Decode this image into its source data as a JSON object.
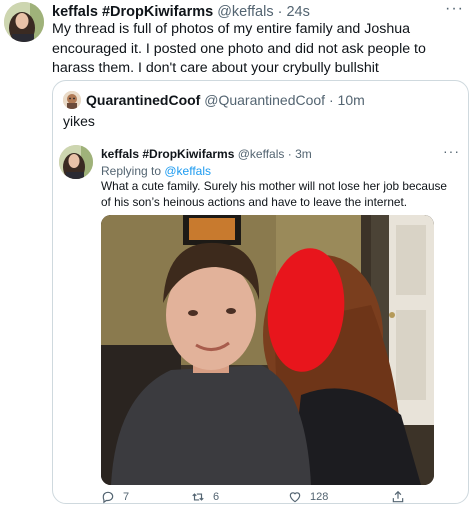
{
  "main_tweet": {
    "display_name": "keffals #DropKiwifarms",
    "handle": "@keffals",
    "separator": "·",
    "time": "24s",
    "text": "My thread is full of photos of my entire family and Joshua encouraged it. I posted one photo and did not ask people to harass them. I don't care about your crybully bullshit",
    "more_icon": "more-dots-icon"
  },
  "quoted_tweet": {
    "display_name": "QuarantinedCoof",
    "handle": "@QuarantinedCoof",
    "separator": "·",
    "time": "10m",
    "text": "yikes"
  },
  "inner_tweet": {
    "display_name": "keffals #DropKiwifarms",
    "handle": "@keffals",
    "separator": "·",
    "time": "3m",
    "replying_prefix": "Replying to ",
    "replying_handle": "@keffals",
    "text": "What a cute family. Surely his mother will not lose her job because of his son’s heinous actions and have to leave the internet.",
    "photo_description_icon": "family-photo-image"
  },
  "actions": {
    "reply_count": "7",
    "retweet_count": "6",
    "like_count": "128",
    "icons": [
      "reply-icon",
      "retweet-icon",
      "like-icon",
      "share-icon"
    ]
  },
  "colors": {
    "text_primary": "#0f1419",
    "text_secondary": "#536471",
    "link": "#1d9bf0",
    "border": "#cfd9de",
    "redaction": "#e8151c"
  }
}
